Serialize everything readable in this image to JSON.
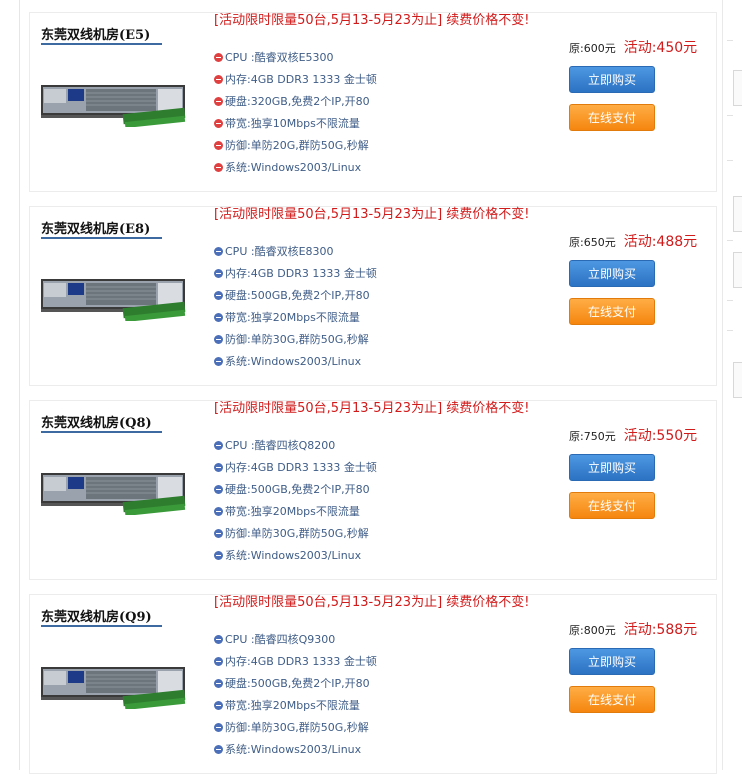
{
  "products": [
    {
      "title": "东莞双线机房(E5)",
      "promo": "[活动限时限量50台,5月13-5月23为止] 续费价格不变!",
      "icon_color": "#e04040",
      "specs": [
        "CPU :酷睿双核E5300",
        "内存:4GB DDR3 1333 金士顿",
        "硬盘:320GB,免费2个IP,开80",
        "带宽:独享10Mbps不限流量",
        "防御:单防20G,群防50G,秒解",
        "系统:Windows2003/Linux"
      ],
      "original_price": "原:600元",
      "promo_price": "活动:450元",
      "buy_label": "立即购买",
      "pay_label": "在线支付"
    },
    {
      "title": "东莞双线机房(E8)",
      "promo": "[活动限时限量50台,5月13-5月23为止] 续费价格不变!",
      "icon_color": "#4b6fb8",
      "specs": [
        "CPU :酷睿双核E8300",
        "内存:4GB DDR3 1333 金士顿",
        "硬盘:500GB,免费2个IP,开80",
        "带宽:独享20Mbps不限流量",
        "防御:单防30G,群防50G,秒解",
        "系统:Windows2003/Linux"
      ],
      "original_price": "原:650元",
      "promo_price": "活动:488元",
      "buy_label": "立即购买",
      "pay_label": "在线支付"
    },
    {
      "title": "东莞双线机房(Q8)",
      "promo": "[活动限时限量50台,5月13-5月23为止] 续费价格不变!",
      "icon_color": "#4b6fb8",
      "specs": [
        "CPU :酷睿四核Q8200",
        "内存:4GB DDR3 1333 金士顿",
        "硬盘:500GB,免费2个IP,开80",
        "带宽:独享20Mbps不限流量",
        "防御:单防30G,群防50G,秒解",
        "系统:Windows2003/Linux"
      ],
      "original_price": "原:750元",
      "promo_price": "活动:550元",
      "buy_label": "立即购买",
      "pay_label": "在线支付"
    },
    {
      "title": "东莞双线机房(Q9)",
      "promo": "[活动限时限量50台,5月13-5月23为止] 续费价格不变!",
      "icon_color": "#4b6fb8",
      "specs": [
        "CPU :酷睿四核Q9300",
        "内存:4GB DDR3 1333 金士顿",
        "硬盘:500GB,免费2个IP,开80",
        "带宽:独享20Mbps不限流量",
        "防御:单防30G,群防50G,秒解",
        "系统:Windows2003/Linux"
      ],
      "original_price": "原:800元",
      "promo_price": "活动:588元",
      "buy_label": "立即购买",
      "pay_label": "在线支付"
    }
  ]
}
